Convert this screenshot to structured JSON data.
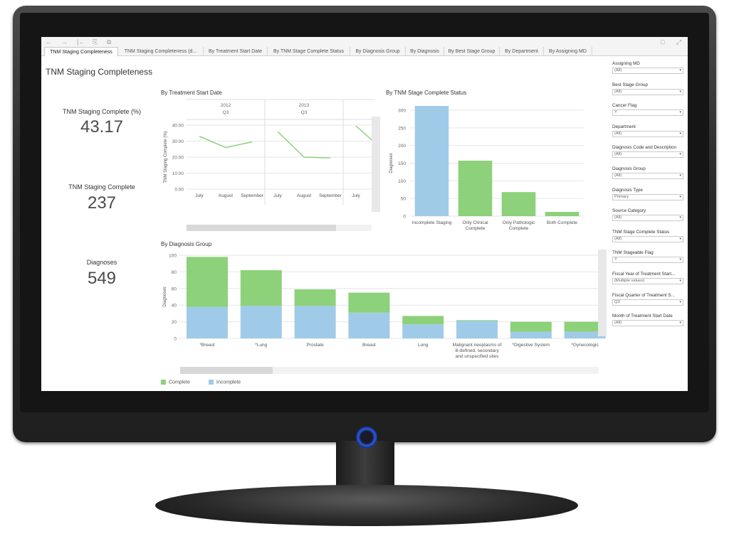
{
  "toolbar": {
    "icons": [
      "back-arrow-icon",
      "forward-arrow-icon",
      "revert-icon",
      "copy-icon",
      "paste-icon",
      "comment-icon",
      "fullscreen-icon"
    ],
    "glyphs": {
      "back": "←",
      "forward": "→",
      "revert": "|←",
      "copy": "⎘",
      "paste": "⧉",
      "comment": "□",
      "fullscreen": "⤢"
    }
  },
  "tabs": [
    {
      "label": "TNM Staging Completeness",
      "active": true
    },
    {
      "label": "TNM Staging Completeness (d...",
      "active": false
    },
    {
      "label": "By Treatment Start Date",
      "active": false
    },
    {
      "label": "By TNM Stage Complete Status",
      "active": false
    },
    {
      "label": "By Diagnosis Group",
      "active": false
    },
    {
      "label": "By Diagnosis",
      "active": false
    },
    {
      "label": "By Best Stage Group",
      "active": false
    },
    {
      "label": "By Department",
      "active": false
    },
    {
      "label": "By Assigning MD",
      "active": false
    }
  ],
  "page_title": "TNM Staging Completeness",
  "kpis": [
    {
      "label": "TNM Staging Complete (%)",
      "value": "43.17"
    },
    {
      "label": "TNM Staging Complete",
      "value": "237"
    },
    {
      "label": "Diagnoses",
      "value": "549"
    }
  ],
  "colors": {
    "complete": "#8dd17a",
    "incomplete": "#a0cbe8",
    "line": "#8dd17a",
    "grid": "#e6e6e6",
    "axis": "#999999"
  },
  "legend": [
    {
      "label": "Complete",
      "color": "#8dd17a"
    },
    {
      "label": "Incomplete",
      "color": "#a0cbe8"
    }
  ],
  "chart_data": [
    {
      "type": "line",
      "title": "By Treatment Start Date",
      "ylabel": "TNM Staging Complete (%)",
      "ylim": [
        0,
        40
      ],
      "yticks": [
        "40.00",
        "30.00",
        "20.00",
        "10.00",
        "0.00"
      ],
      "panels": [
        {
          "year": "2012",
          "quarter": "Q3",
          "x": [
            "July",
            "August",
            "September"
          ],
          "values": [
            33,
            26,
            29.5
          ]
        },
        {
          "year": "2013",
          "quarter": "Q3",
          "x": [
            "July",
            "August",
            "September"
          ],
          "values": [
            36,
            20,
            19.5
          ]
        },
        {
          "year": "",
          "quarter": "",
          "x": [
            "July"
          ],
          "values": [
            39.5
          ]
        }
      ]
    },
    {
      "type": "bar",
      "title": "By TNM Stage Complete Status",
      "ylabel": "Diagnoses",
      "ylim": [
        0,
        300
      ],
      "yticks": [
        0,
        50,
        100,
        150,
        200,
        250,
        300
      ],
      "categories": [
        "Incomplete Staging",
        "Only Clinical Complete",
        "Only Pathologic Complete",
        "Both Complete"
      ],
      "category_lines": [
        [
          "Incomplete Staging"
        ],
        [
          "Only Clinical",
          "Complete"
        ],
        [
          "Only Pathologic",
          "Complete"
        ],
        [
          "Both Complete"
        ]
      ],
      "values": [
        312,
        157,
        68,
        12
      ],
      "colors": [
        "#a0cbe8",
        "#8dd17a",
        "#8dd17a",
        "#8dd17a"
      ]
    },
    {
      "type": "bar",
      "stacked": true,
      "title": "By Diagnosis Group",
      "ylabel": "Diagnoses",
      "ylim": [
        0,
        100
      ],
      "yticks": [
        0,
        20,
        40,
        60,
        80,
        100
      ],
      "categories": [
        "*Breast",
        "*Lung",
        "Prostate",
        "Breast",
        "Lung",
        "Malignant neoplasms of ill-defined, secondary and unspecified sites",
        "*Digestive System",
        "*Gynecologic"
      ],
      "category_lines": [
        [
          "*Breast"
        ],
        [
          "*Lung"
        ],
        [
          "Prostate"
        ],
        [
          "Breast"
        ],
        [
          "Lung"
        ],
        [
          "Malignant neoplasms of",
          "ill-defined, secondary",
          "and unspecified sites"
        ],
        [
          "*Digestive System"
        ],
        [
          "*Gynecologic"
        ]
      ],
      "series": [
        {
          "name": "Incomplete",
          "values": [
            38,
            39,
            39,
            31,
            17,
            21,
            8,
            8
          ]
        },
        {
          "name": "Complete",
          "values": [
            60,
            43,
            20,
            24,
            10,
            1,
            12,
            12
          ]
        }
      ]
    }
  ],
  "filters": [
    {
      "label": "Assigning MD",
      "value": "(All)"
    },
    {
      "label": "Best Stage Group",
      "value": "(All)"
    },
    {
      "label": "Cancer Flag",
      "value": "Y"
    },
    {
      "label": "Department",
      "value": "(All)"
    },
    {
      "label": "Diagnosis Code and Description",
      "value": "(All)"
    },
    {
      "label": "Diagnosis Group",
      "value": "(All)"
    },
    {
      "label": "Diagnosis Type",
      "value": "Primary"
    },
    {
      "label": "Source Category",
      "value": "(All)"
    },
    {
      "label": "TNM Stage Complete Status",
      "value": "(All)"
    },
    {
      "label": "TNM Stageable Flag",
      "value": "Y"
    },
    {
      "label": "Fiscal Year of Treatment Start...",
      "value": "(Multiple values)"
    },
    {
      "label": "Fiscal Quarter of Treatment S...",
      "value": "Q3"
    },
    {
      "label": "Month of Treatment Start Date",
      "value": "(All)"
    }
  ]
}
